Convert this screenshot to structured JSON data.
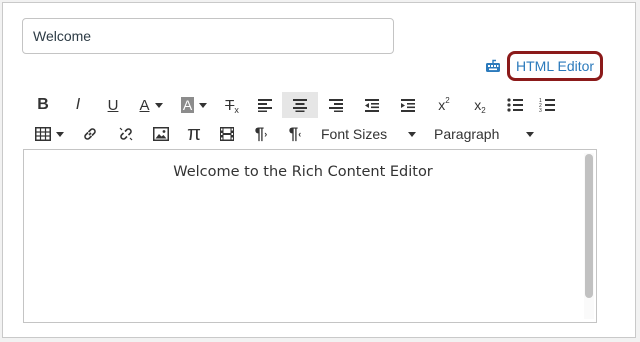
{
  "title_field": {
    "value": "Welcome",
    "placeholder": ""
  },
  "html_editor": {
    "label": "HTML Editor",
    "icon": "keyboard-icon"
  },
  "toolbar": {
    "bold_glyph": "B",
    "italic_glyph": "I",
    "underline_glyph": "U",
    "text_color_glyph": "A",
    "background_color_glyph": "A",
    "clear_format_glyph": "T",
    "clear_format_sub": "x",
    "superscript_glyph": "x",
    "superscript_exp": "2",
    "subscript_glyph": "x",
    "subscript_exp": "2",
    "pi_glyph": "π",
    "pilcrow_glyph": "¶",
    "font_sizes_label": "Font Sizes",
    "paragraph_label": "Paragraph"
  },
  "editor": {
    "content": "Welcome to the Rich Content Editor"
  },
  "colors": {
    "link": "#2b7abc",
    "highlight_border": "#8b1a1a"
  }
}
